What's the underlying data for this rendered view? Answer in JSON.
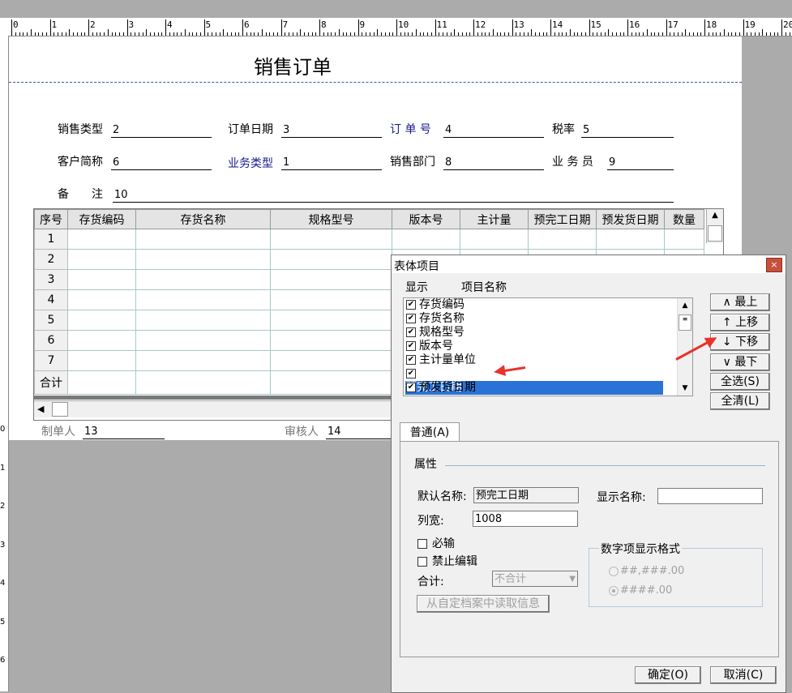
{
  "ruler": {
    "numbers": [
      "0",
      "1",
      "2",
      "3",
      "4",
      "5",
      "6",
      "7",
      "8",
      "9",
      "10",
      "11",
      "12",
      "13",
      "14",
      "15",
      "16",
      "17",
      "18",
      "19",
      "20"
    ]
  },
  "vruler": {
    "numbers": [
      "0",
      "1",
      "2",
      "3",
      "4",
      "5",
      "6"
    ]
  },
  "form": {
    "title": "销售订单",
    "fields": {
      "sales_type": {
        "label": "销售类型",
        "value": "2"
      },
      "order_date": {
        "label": "订单日期",
        "value": "3"
      },
      "order_no": {
        "label": "订 单 号",
        "value": "4"
      },
      "tax_rate": {
        "label": "税率",
        "value": "5"
      },
      "customer": {
        "label": "客户简称",
        "value": "6"
      },
      "biz_type": {
        "label": "业务类型",
        "value": "1"
      },
      "sales_dept": {
        "label": "销售部门",
        "value": "8"
      },
      "salesman": {
        "label": "业 务 员",
        "value": "9"
      },
      "remark": {
        "label": "备　　注",
        "value": "10"
      }
    },
    "grid": {
      "headers": [
        "序号",
        "存货编码",
        "存货名称",
        "规格型号",
        "版本号",
        "主计量",
        "预完工日期",
        "预发货日期",
        "数量"
      ],
      "rows": [
        "1",
        "2",
        "3",
        "4",
        "5",
        "6",
        "7"
      ],
      "total_label": "合计"
    },
    "footer": {
      "maker": {
        "label": "制单人",
        "value": "13"
      },
      "reviewer": {
        "label": "审核人",
        "value": "14"
      }
    }
  },
  "dialog": {
    "title": "表体项目",
    "close": "×",
    "list_headers": {
      "show": "显示",
      "name": "项目名称"
    },
    "items": [
      "存货编码",
      "存货名称",
      "规格型号",
      "版本号",
      "主计量单位",
      "预完工日期",
      "预发货日期"
    ],
    "selected_index": 5,
    "buttons": {
      "top": "∧ 最上",
      "up": "↑ 上移",
      "down": "↓ 下移",
      "bottom": "∨ 最下",
      "select_all": "全选(S)",
      "clear_all": "全清(L)",
      "ok": "确定(O)",
      "cancel": "取消(C)"
    },
    "tab": "普通(A)",
    "properties": {
      "group": "属性",
      "default_name_label": "默认名称:",
      "default_name_value": "预完工日期",
      "display_name_label": "显示名称:",
      "display_name_value": "",
      "width_label": "列宽:",
      "width_value": "1008",
      "required_label": "必输",
      "no_edit_label": "禁止编辑",
      "total_label": "合计:",
      "total_value": "不合计",
      "read_button": "从自定档案中读取信息",
      "numfmt_group": "数字项显示格式",
      "numfmt_opt1": "##,###.00",
      "numfmt_opt2": "####.00"
    }
  },
  "colors": {
    "selection": "#2a73d6",
    "arrow": "#e8332a",
    "background": "#ababab"
  }
}
